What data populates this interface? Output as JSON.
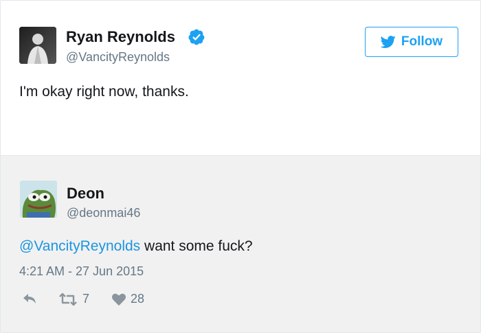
{
  "tweet": {
    "author_name": "Ryan Reynolds",
    "author_handle": "@VancityReynolds",
    "verified_icon": "verified-badge-icon",
    "follow_label": "Follow",
    "text": "I'm okay right now, thanks."
  },
  "reply": {
    "author_name": "Deon",
    "author_handle": "@deonmai46",
    "mention": "@VancityReynolds",
    "text": " want some fuck?",
    "timestamp": "4:21 AM - 27 Jun 2015",
    "retweet_count": "7",
    "like_count": "28"
  },
  "colors": {
    "accent": "#1da1f2",
    "link": "#1b95e0",
    "secondary_text": "#657786",
    "reply_background": "#f1f1f1"
  }
}
